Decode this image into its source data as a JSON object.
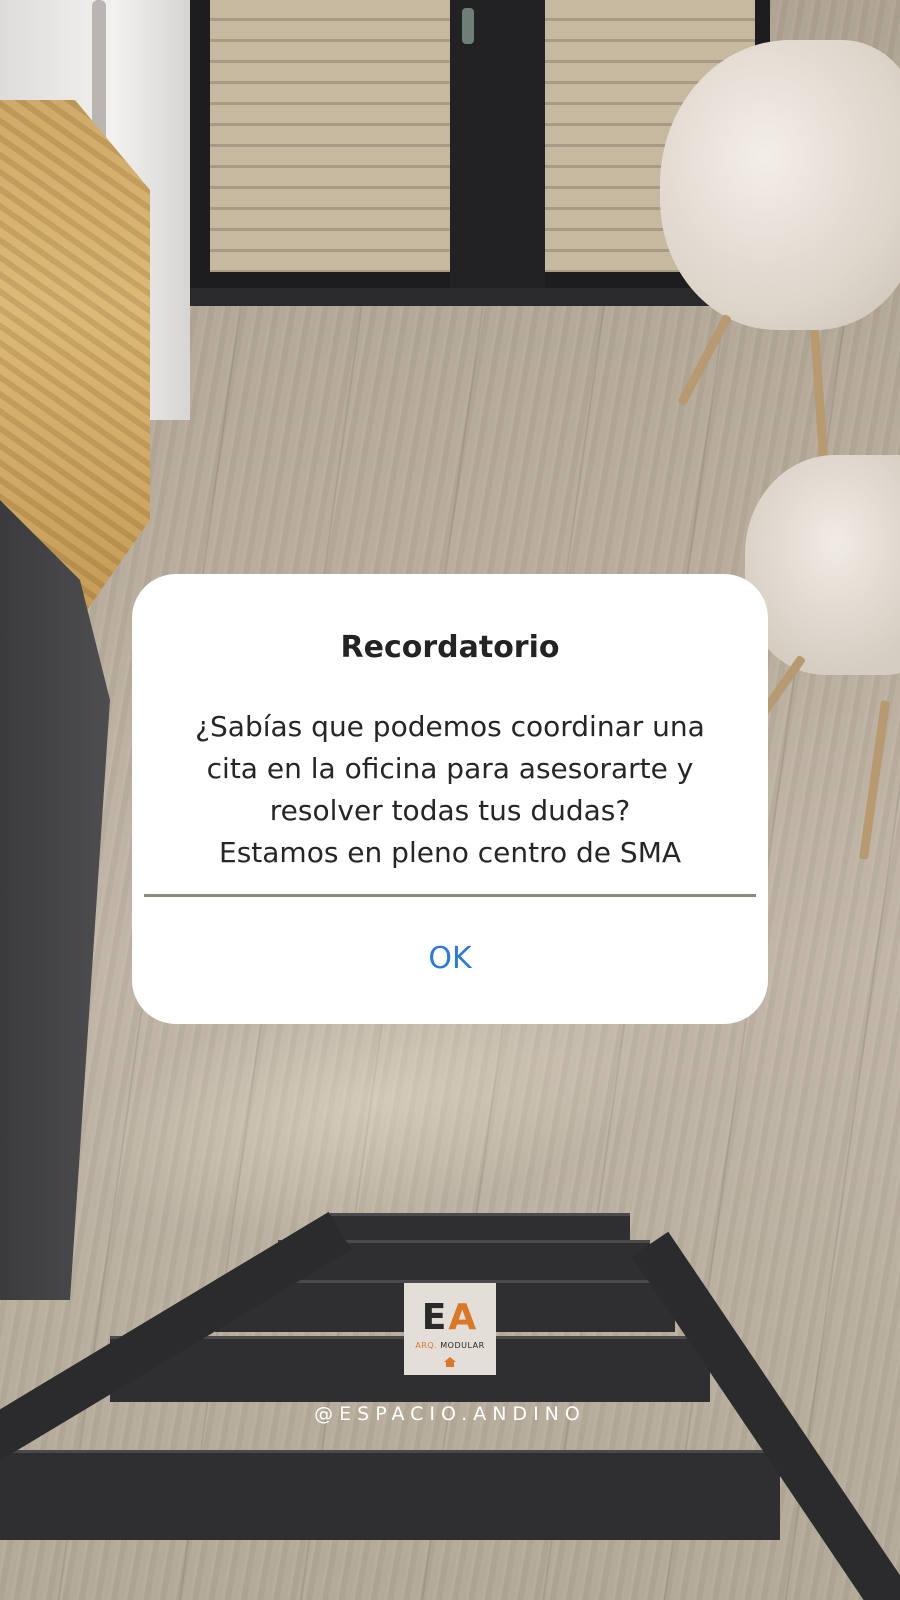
{
  "dialog": {
    "title": "Recordatorio",
    "message_lines": [
      "¿Sabías que podemos coordinar una",
      "cita en la oficina para asesorarte y",
      "resolver todas tus dudas?",
      "Estamos en pleno centro de SMA"
    ],
    "ok_label": "OK"
  },
  "brand": {
    "logo_letter_1": "E",
    "logo_letter_2": "A",
    "logo_sub_1": "ARQ.",
    "logo_sub_2": "MODULAR",
    "handle": "@ESPACIO.ANDINO",
    "accent_color": "#d9782b"
  },
  "colors": {
    "button_text": "#2f7ad0",
    "dialog_background": "#ffffff"
  }
}
